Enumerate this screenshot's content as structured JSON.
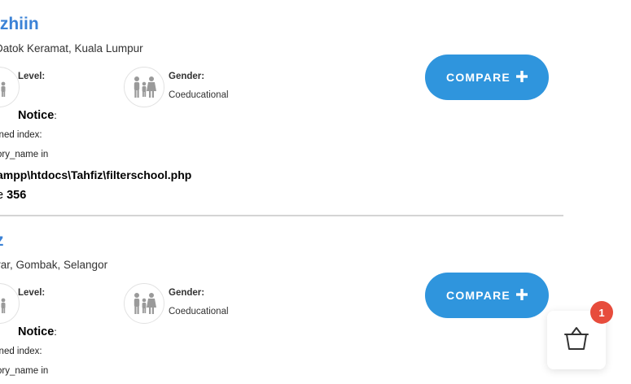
{
  "schools": [
    {
      "name": "izhiin",
      "location": "Datok Keramat, Kuala Lumpur",
      "level_label": "Level:",
      "gender_label": "Gender:",
      "gender_value": "Coeducational",
      "notice_label": "Notice",
      "notice_colon": ":",
      "error_line1": "ined index:",
      "error_line2": "ory_name in",
      "error_path": "ampp\\htdocs\\Tahfiz\\filterschool.php",
      "error_line_prefix": "e ",
      "error_line_number": "356",
      "compare_label": "COMPARE",
      "compare_icon": "plus-icon"
    },
    {
      "name": "z",
      "location": "var, Gombak, Selangor",
      "level_label": "Level:",
      "gender_label": "Gender:",
      "gender_value": "Coeducational",
      "notice_label": "Notice",
      "notice_colon": ":",
      "error_line1": "ined index:",
      "error_line2": "ory_name in",
      "compare_label": "COMPARE",
      "compare_icon": "plus-icon"
    }
  ],
  "cart": {
    "count": "1",
    "icon": "basket-icon"
  },
  "colors": {
    "accent": "#2f95dd",
    "title": "#3b82d6",
    "badge": "#e74c3c"
  }
}
